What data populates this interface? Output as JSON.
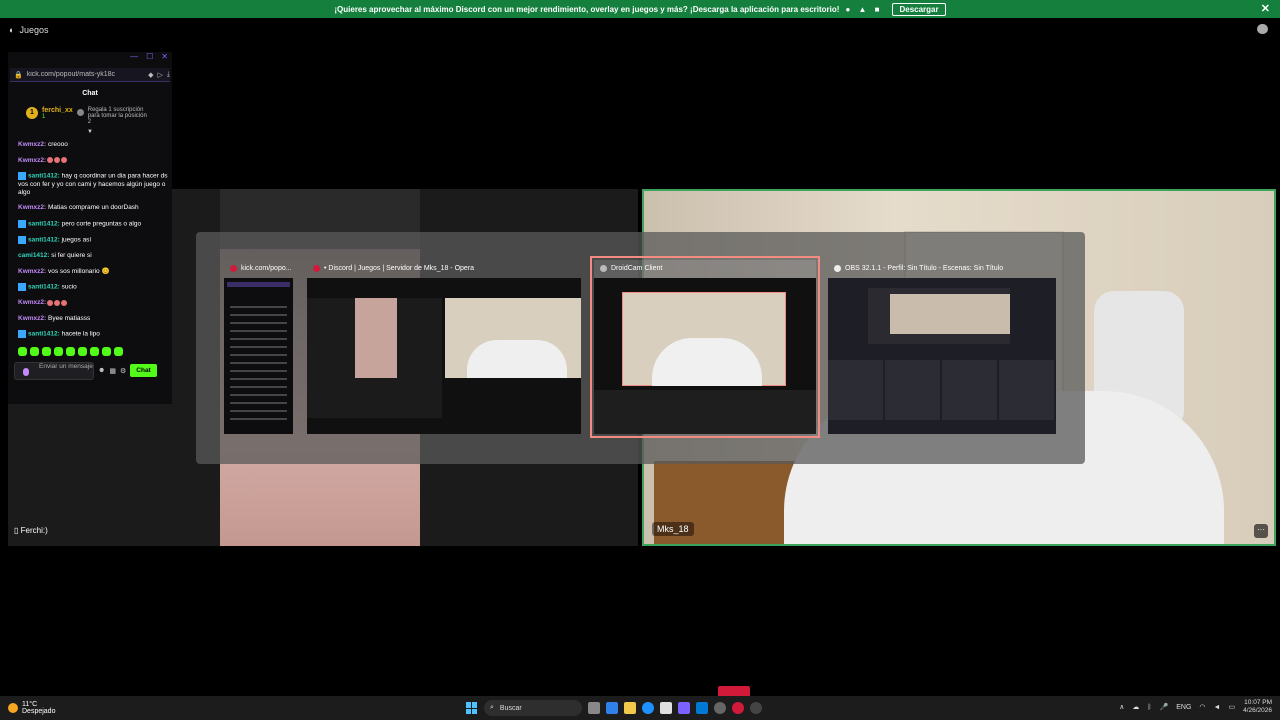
{
  "banner": {
    "text": "¡Quieres aprovechar al máximo Discord con un mejor rendimiento, overlay en juegos y más? ¡Descarga la aplicación para escritorio!",
    "os_icons": "  ",
    "download_label": "Descargar",
    "close_glyph": "✕"
  },
  "topbar": {
    "speaker_glyph": "◖",
    "channel": "Juegos"
  },
  "chat_popout": {
    "url": "kick.com/popout/mats-yk18c",
    "title": "Chat",
    "pinned": {
      "rank": "1",
      "user": "ferchi_xx",
      "count": "1",
      "gift_text": "Regala 1 suscripción para tomar la posición 2"
    },
    "messages": [
      {
        "user": "Kwmxz2:",
        "text": " creooo",
        "style": "u1",
        "badge": false
      },
      {
        "user": "Kwmxz2:",
        "text": "",
        "style": "u1",
        "badge": false,
        "emotes": 3
      },
      {
        "user": "santi1412:",
        "text": " hay q coordinar un dia para hacer ds vos con fer y yo con cami y hacemos algún juego o algo",
        "style": "u3",
        "badge": true
      },
      {
        "user": "Kwmxz2:",
        "text": " Matias comprame un doorDash",
        "style": "u1",
        "badge": false
      },
      {
        "user": "santi1412:",
        "text": " pero corte preguntas o algo",
        "style": "u3",
        "badge": true
      },
      {
        "user": "santi1412:",
        "text": " juegos así",
        "style": "u3",
        "badge": true
      },
      {
        "user": "cami1412:",
        "text": " si fer quiere si",
        "style": "u3",
        "badge": false
      },
      {
        "user": "Kwmxz2:",
        "text": " vos sos millonario 😊",
        "style": "u1",
        "badge": false
      },
      {
        "user": "santi1412:",
        "text": " sucio",
        "style": "u3",
        "badge": true
      },
      {
        "user": "Kwmxz2:",
        "text": "",
        "style": "u1",
        "badge": false,
        "emotes": 3
      },
      {
        "user": "Kwmxz2:",
        "text": " Byee matiasss",
        "style": "u1",
        "badge": false
      },
      {
        "user": "santi1412:",
        "text": " hacete la lipo",
        "style": "u3",
        "badge": true
      }
    ],
    "input_placeholder": "Enviar un mensaje",
    "send_label": "Chat"
  },
  "participants": {
    "left_label": "Ferchi:)",
    "right_label": "Mks_18"
  },
  "switcher": {
    "windows": [
      {
        "title": "kick.com/popo..."
      },
      {
        "title": "• Discord | Juegos | Servidor de Mks_18 - Opera"
      },
      {
        "title": "DroidCam Client"
      },
      {
        "title": "OBS 32.1.1 - Perfil: Sin Título - Escenas: Sin Título"
      }
    ]
  },
  "taskbar": {
    "temp": "11°C",
    "weather": "Despejado",
    "search_label": "Buscar",
    "lang": "ENG",
    "time": "10:07 PM",
    "date": "4/26/2026"
  },
  "colors": {
    "accent_green": "#3ba55c",
    "kick_green": "#53fc18",
    "selection": "#f28b82"
  }
}
